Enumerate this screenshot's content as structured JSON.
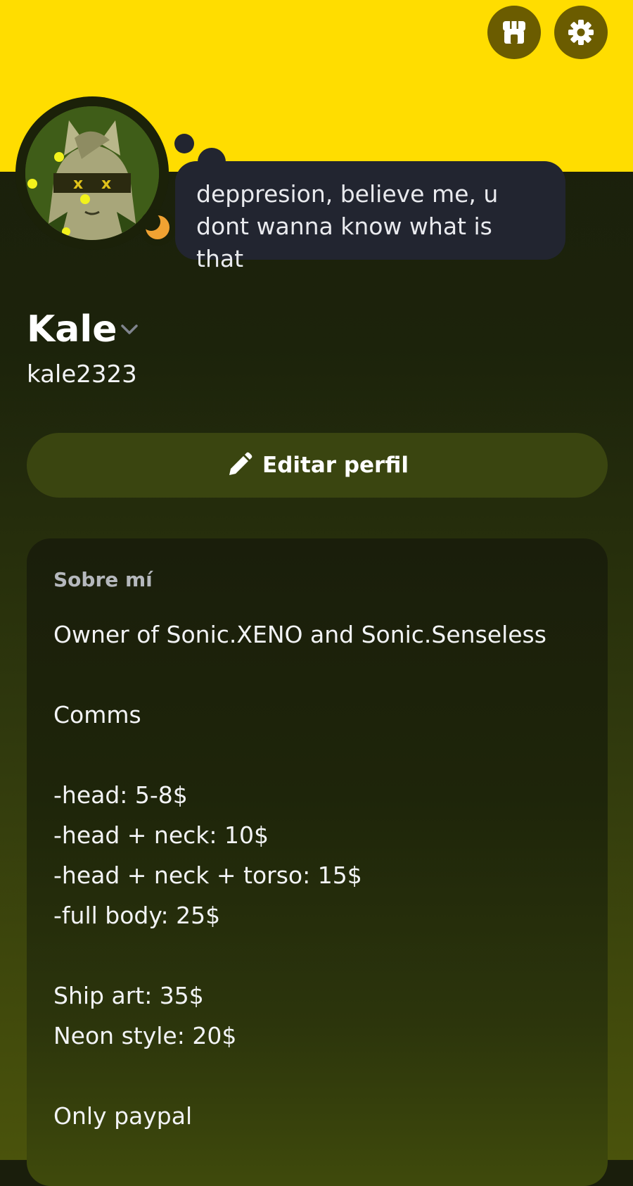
{
  "header": {
    "banner_color": "#ffdd00",
    "shop_icon": "shop-icon",
    "settings_icon": "gear-icon"
  },
  "profile": {
    "status_text": "deppresion, believe me, u dont wanna know what is that",
    "display_name": "Kale",
    "username": "kale2323",
    "presence": "idle",
    "presence_color": "#f0a232"
  },
  "actions": {
    "edit_profile_label": "Editar perfil"
  },
  "about": {
    "title": "Sobre mí",
    "lines": [
      "Owner of Sonic.XENO and Sonic.Senseless",
      "",
      "Comms",
      "",
      "-head: 5-8$",
      "-head + neck: 10$",
      "-head + neck + torso: 15$",
      "-full body: 25$",
      "",
      "Ship art: 35$",
      "Neon style: 20$",
      "",
      "Only paypal"
    ]
  }
}
